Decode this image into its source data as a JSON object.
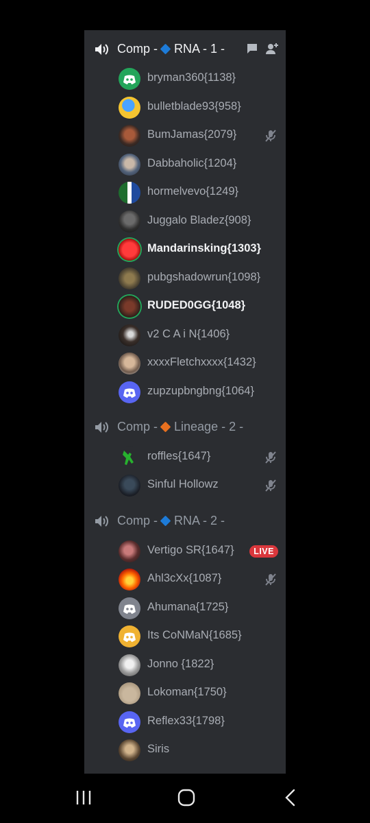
{
  "colors": {
    "panel_bg": "#2b2d31",
    "rna_gem": "#1d7bd8",
    "lineage_gem": "#e8701f",
    "speaking_ring": "#23a55a",
    "live_badge": "#da373c"
  },
  "channels": [
    {
      "name_prefix": "Comp -",
      "gem_color": "#1d7bd8",
      "name_suffix": "RNA - 1 -",
      "active": true,
      "header_icons": [
        "chat-icon",
        "add-member-icon"
      ],
      "members": [
        {
          "name": "bryman360{1138}",
          "avatar": "discord-green",
          "muted": false,
          "speaking": false
        },
        {
          "name": "bulletblade93{958}",
          "avatar": "blue-cartoon",
          "muted": false,
          "speaking": false
        },
        {
          "name": "BumJamas{2079}",
          "avatar": "photo",
          "muted": true,
          "speaking": false
        },
        {
          "name": "Dabbaholic{1204}",
          "avatar": "photo",
          "muted": false,
          "speaking": false
        },
        {
          "name": "hormelvevo{1249}",
          "avatar": "photo",
          "muted": false,
          "speaking": false
        },
        {
          "name": "Juggalo Bladez{908}",
          "avatar": "photo",
          "muted": false,
          "speaking": false
        },
        {
          "name": "Mandarinsking{1303}",
          "avatar": "red-character",
          "muted": false,
          "speaking": true
        },
        {
          "name": "pubgshadowrun{1098}",
          "avatar": "photo",
          "muted": false,
          "speaking": false
        },
        {
          "name": "RUDED0GG{1048}",
          "avatar": "photo",
          "muted": false,
          "speaking": true
        },
        {
          "name": "v2 C A i N{1406}",
          "avatar": "photo",
          "muted": false,
          "speaking": false
        },
        {
          "name": "xxxxFletchxxxx{1432}",
          "avatar": "photo",
          "muted": false,
          "speaking": false
        },
        {
          "name": "zupzupbngbng{1064}",
          "avatar": "discord-blurple",
          "muted": false,
          "speaking": false
        }
      ]
    },
    {
      "name_prefix": "Comp -",
      "gem_color": "#e8701f",
      "name_suffix": "Lineage - 2 -",
      "active": false,
      "header_icons": [],
      "members": [
        {
          "name": "roffles{1647}",
          "avatar": "green-figure",
          "muted": true,
          "speaking": false
        },
        {
          "name": "Sinful Hollowz",
          "avatar": "photo",
          "muted": true,
          "speaking": false
        }
      ]
    },
    {
      "name_prefix": "Comp -",
      "gem_color": "#1d7bd8",
      "name_suffix": "RNA - 2 -",
      "active": false,
      "header_icons": [],
      "members": [
        {
          "name": "Vertigo SR{1647}",
          "avatar": "photo",
          "muted": false,
          "speaking": false,
          "live": "LIVE"
        },
        {
          "name": "Ahl3cXx{1087}",
          "avatar": "fire",
          "muted": true,
          "speaking": false
        },
        {
          "name": "Ahumana{1725}",
          "avatar": "discord-grey",
          "muted": false,
          "speaking": false
        },
        {
          "name": "Its CoNMaN{1685}",
          "avatar": "discord-orange",
          "muted": false,
          "speaking": false
        },
        {
          "name": "Jonno {1822}",
          "avatar": "photo",
          "muted": false,
          "speaking": false
        },
        {
          "name": "Lokoman{1750}",
          "avatar": "photo",
          "muted": false,
          "speaking": false
        },
        {
          "name": "Reflex33{1798}",
          "avatar": "discord-blurple",
          "muted": false,
          "speaking": false
        },
        {
          "name": "Siris",
          "avatar": "photo",
          "muted": false,
          "speaking": false
        }
      ]
    }
  ],
  "navbar": {
    "icons": [
      "recent-apps-icon",
      "home-icon",
      "back-icon"
    ]
  }
}
